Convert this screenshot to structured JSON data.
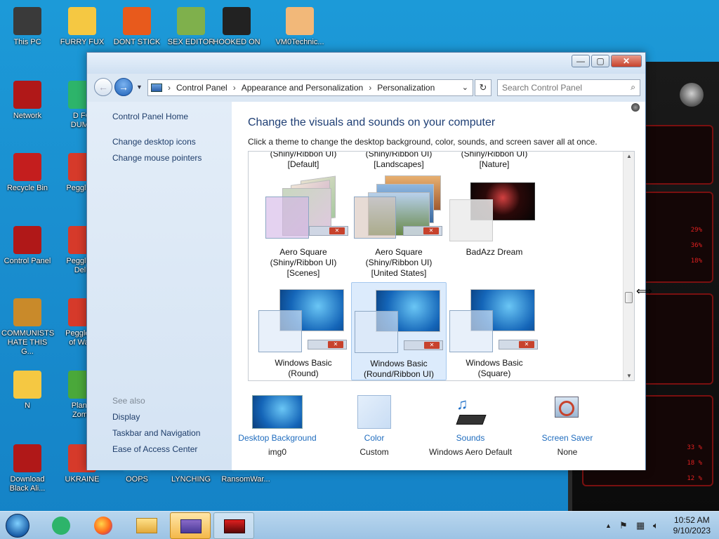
{
  "desktop": {
    "icons": [
      {
        "label": "This PC",
        "color": "#3a3a3a"
      },
      {
        "label": "FURRY FUX",
        "color": "#f5c842"
      },
      {
        "label": "DONT STICK",
        "color": "#e85a1c"
      },
      {
        "label": "SEX EDITOR",
        "color": "#7fb04c"
      },
      {
        "label": "HOOKED ON",
        "color": "#222222"
      },
      {
        "label": "VM0Technic...",
        "color": "#f2b879"
      },
      {
        "label": "Network",
        "color": "#b01818"
      },
      {
        "label": "D FO\nDUMB",
        "color": "#2db46a"
      },
      {
        "label": "Recycle Bin",
        "color": "#c41e1e"
      },
      {
        "label": "Peggle D",
        "color": "#d63a2a"
      },
      {
        "label": "Control Panel",
        "color": "#b01818"
      },
      {
        "label": "Peggle N\nDelu",
        "color": "#d63a2a"
      },
      {
        "label": "COMMUNISTS\nHATE THIS G...",
        "color": "#c98a2a"
      },
      {
        "label": "Peggle W\nof Warc",
        "color": "#d63a2a"
      },
      {
        "label": "N",
        "color": "#f5c842"
      },
      {
        "label": "Plants\nZomb",
        "color": "#4aa83a"
      },
      {
        "label": "Download\nBlack Ali...",
        "color": "#b01818"
      },
      {
        "label": "UKRAINE",
        "color": "#d63a2a"
      },
      {
        "label": "OOPS",
        "color": "#1a8fd0"
      },
      {
        "label": "LYNCHING",
        "color": "#1a8fd0"
      },
      {
        "label": "RansomWar...",
        "color": "#1a8fd0"
      }
    ],
    "widget_readouts": [
      "29%",
      "36%",
      "18%",
      "33 %",
      "18 %",
      "12 %"
    ]
  },
  "window": {
    "controls": {
      "minimize": "—",
      "maximize": "▢",
      "close": "✕"
    },
    "breadcrumb": [
      "Control Panel",
      "Appearance and Personalization",
      "Personalization"
    ],
    "breadcrumb_sep": "›",
    "search_placeholder": "Search Control Panel",
    "left_pane": {
      "home": "Control Panel Home",
      "links": [
        "Change desktop icons",
        "Change mouse pointers"
      ],
      "see_also_title": "See also",
      "see_also": [
        "Display",
        "Taskbar and Navigation",
        "Ease of Access Center"
      ]
    },
    "heading": "Change the visuals and sounds on your computer",
    "subtext": "Click a theme to change the desktop background, color, sounds, and screen saver all at once.",
    "themes_top_row": [
      {
        "line1": "(Shiny/Ribbon UI)",
        "line2": "[Default]"
      },
      {
        "line1": "(Shiny/Ribbon UI)",
        "line2": "[Landscapes]"
      },
      {
        "line1": "(Shiny/Ribbon UI)",
        "line2": "[Nature]"
      }
    ],
    "themes_mid_row": [
      {
        "line1": "Aero Square",
        "line2": "(Shiny/Ribbon UI)",
        "line3": "[Scenes]"
      },
      {
        "line1": "Aero Square",
        "line2": "(Shiny/Ribbon UI)",
        "line3": "[United States]"
      },
      {
        "line1": "BadAzz Dream",
        "line2": "",
        "line3": ""
      }
    ],
    "themes_bottom_row": [
      {
        "line1": "Windows Basic",
        "line2": "(Round)"
      },
      {
        "line1": "Windows Basic",
        "line2": "(Round/Ribbon UI)"
      },
      {
        "line1": "Windows Basic",
        "line2": "(Square)"
      }
    ],
    "bottom_settings": [
      {
        "link": "Desktop Background",
        "value": "img0"
      },
      {
        "link": "Color",
        "value": "Custom"
      },
      {
        "link": "Sounds",
        "value": "Windows Aero Default"
      },
      {
        "link": "Screen Saver",
        "value": "None"
      }
    ]
  },
  "taskbar": {
    "time": "10:52 AM",
    "date": "9/10/2023",
    "tray_icons": [
      "up-arrow-icon",
      "flag-icon",
      "network-icon",
      "volume-icon"
    ]
  },
  "colors": {
    "accent_link": "#1f6cbe",
    "heading": "#1e3e74",
    "selected_theme": "#dcebfc"
  }
}
